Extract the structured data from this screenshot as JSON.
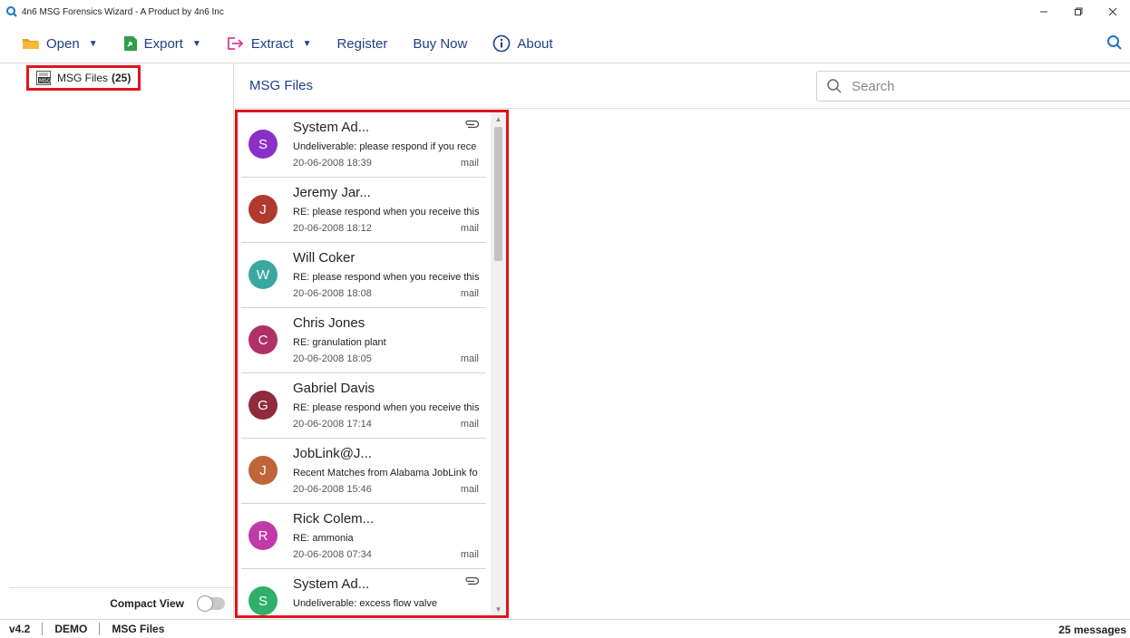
{
  "window": {
    "title": "4n6 MSG Forensics Wizard - A Product by 4n6 Inc"
  },
  "toolbar": {
    "open": "Open",
    "export": "Export",
    "extract": "Extract",
    "register": "Register",
    "buy_now": "Buy Now",
    "about": "About"
  },
  "sidebar": {
    "root_label": "MSG Files",
    "root_count": "(25)",
    "compact_view": "Compact View"
  },
  "main": {
    "title": "MSG Files",
    "search_placeholder": "Search"
  },
  "messages": [
    {
      "initial": "S",
      "color": "#8b2fc9",
      "sender": "System Ad...",
      "subject": "Undeliverable: please respond if you rece",
      "date": "20-06-2008 18:39",
      "type": "mail",
      "attachment": true
    },
    {
      "initial": "J",
      "color": "#b03a2e",
      "sender": "Jeremy Jar...",
      "subject": "RE: please respond when you receive this",
      "date": "20-06-2008 18:12",
      "type": "mail",
      "attachment": false
    },
    {
      "initial": "W",
      "color": "#3aa89e",
      "sender": "Will Coker",
      "subject": "RE: please respond when you receive this",
      "date": "20-06-2008 18:08",
      "type": "mail",
      "attachment": false
    },
    {
      "initial": "C",
      "color": "#b0306a",
      "sender": "Chris Jones",
      "subject": "RE: granulation plant",
      "date": "20-06-2008 18:05",
      "type": "mail",
      "attachment": false
    },
    {
      "initial": "G",
      "color": "#8f2b3d",
      "sender": "Gabriel Davis",
      "subject": "RE: please respond when you receive this",
      "date": "20-06-2008 17:14",
      "type": "mail",
      "attachment": false
    },
    {
      "initial": "J",
      "color": "#c0653a",
      "sender": "JobLink@J...",
      "subject": "Recent Matches from Alabama JobLink fo",
      "date": "20-06-2008 15:46",
      "type": "mail",
      "attachment": false
    },
    {
      "initial": "R",
      "color": "#c03aa8",
      "sender": "Rick Colem...",
      "subject": "RE: ammonia",
      "date": "20-06-2008 07:34",
      "type": "mail",
      "attachment": false
    },
    {
      "initial": "S",
      "color": "#2fb06a",
      "sender": "System Ad...",
      "subject": "Undeliverable: excess flow valve",
      "date": "",
      "type": "",
      "attachment": true
    }
  ],
  "status": {
    "version": "v4.2",
    "mode": "DEMO",
    "location": "MSG Files",
    "count": "25 messages"
  }
}
